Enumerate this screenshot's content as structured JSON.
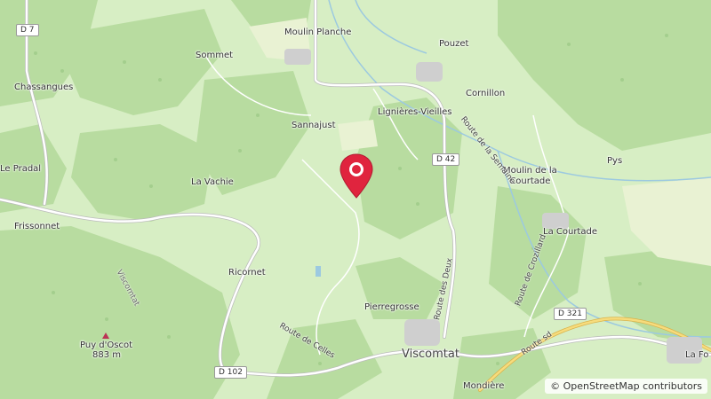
{
  "map": {
    "places": {
      "moulin_planche": "Moulin Planche",
      "pouzet": "Pouzet",
      "sommet": "Sommet",
      "chassangues": "Chassangues",
      "cornillon": "Cornillon",
      "lignieres": "Lignières-Vieilles",
      "sannajust": "Sannajust",
      "pys": "Pys",
      "le_pradal": "Le Pradal",
      "la_vachie": "La Vachie",
      "moulin_courtade": "Moulin de la\nCourtade",
      "la_courtade": "La Courtade",
      "frissonnet": "Frissonnet",
      "ricornet": "Ricornet",
      "pierregrosse": "Pierregrosse",
      "viscomtat": "Viscomtat",
      "viscomtat_area": "Viscomtat",
      "puy_doscot": "Puy d'Oscot",
      "puy_elev": "883 m",
      "mondiere": "Mondière",
      "la_fo": "La Fo"
    },
    "roads": {
      "d7": "D 7",
      "d42": "D 42",
      "d102": "D 102",
      "d321": "D 321",
      "route_semaine": "Route de la Semaine",
      "route_crozillard": "Route de Crozillard",
      "route_deux": "Route des Deux",
      "route_celles": "Route de Celles",
      "route_sd": "Route sd"
    }
  },
  "attribution": {
    "icon": "copyright",
    "text": "© OpenStreetMap contributors"
  },
  "marker": {
    "icon": "map-pin-icon",
    "color": "#e0243e"
  }
}
